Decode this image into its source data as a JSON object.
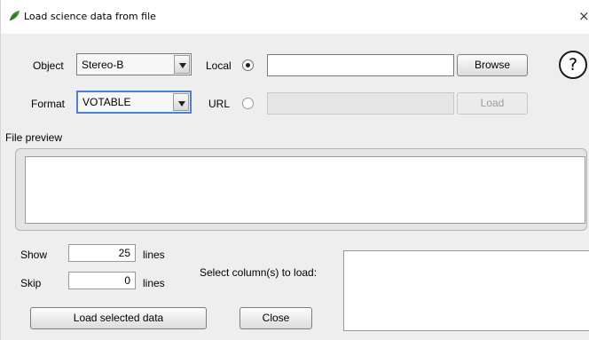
{
  "window": {
    "title": "Load science data from file",
    "title_icon": "leaf-icon",
    "close_glyph": "×"
  },
  "source": {
    "object_label": "Object",
    "object_value": "Stereo-B",
    "format_label": "Format",
    "format_value": "VOTABLE",
    "local_label": "Local",
    "local_selected": true,
    "local_path_value": "",
    "browse_label": "Browse",
    "url_label": "URL",
    "url_selected": false,
    "url_value": "",
    "load_label": "Load",
    "help_glyph": "?"
  },
  "preview": {
    "label": "File preview",
    "content": ""
  },
  "options": {
    "show_label": "Show",
    "show_value": "25",
    "show_unit": "lines",
    "skip_label": "Skip",
    "skip_value": "0",
    "skip_unit": "lines",
    "columns_label": "Select column(s) to load:"
  },
  "actions": {
    "load_selected_label": "Load selected data",
    "close_label": "Close"
  }
}
